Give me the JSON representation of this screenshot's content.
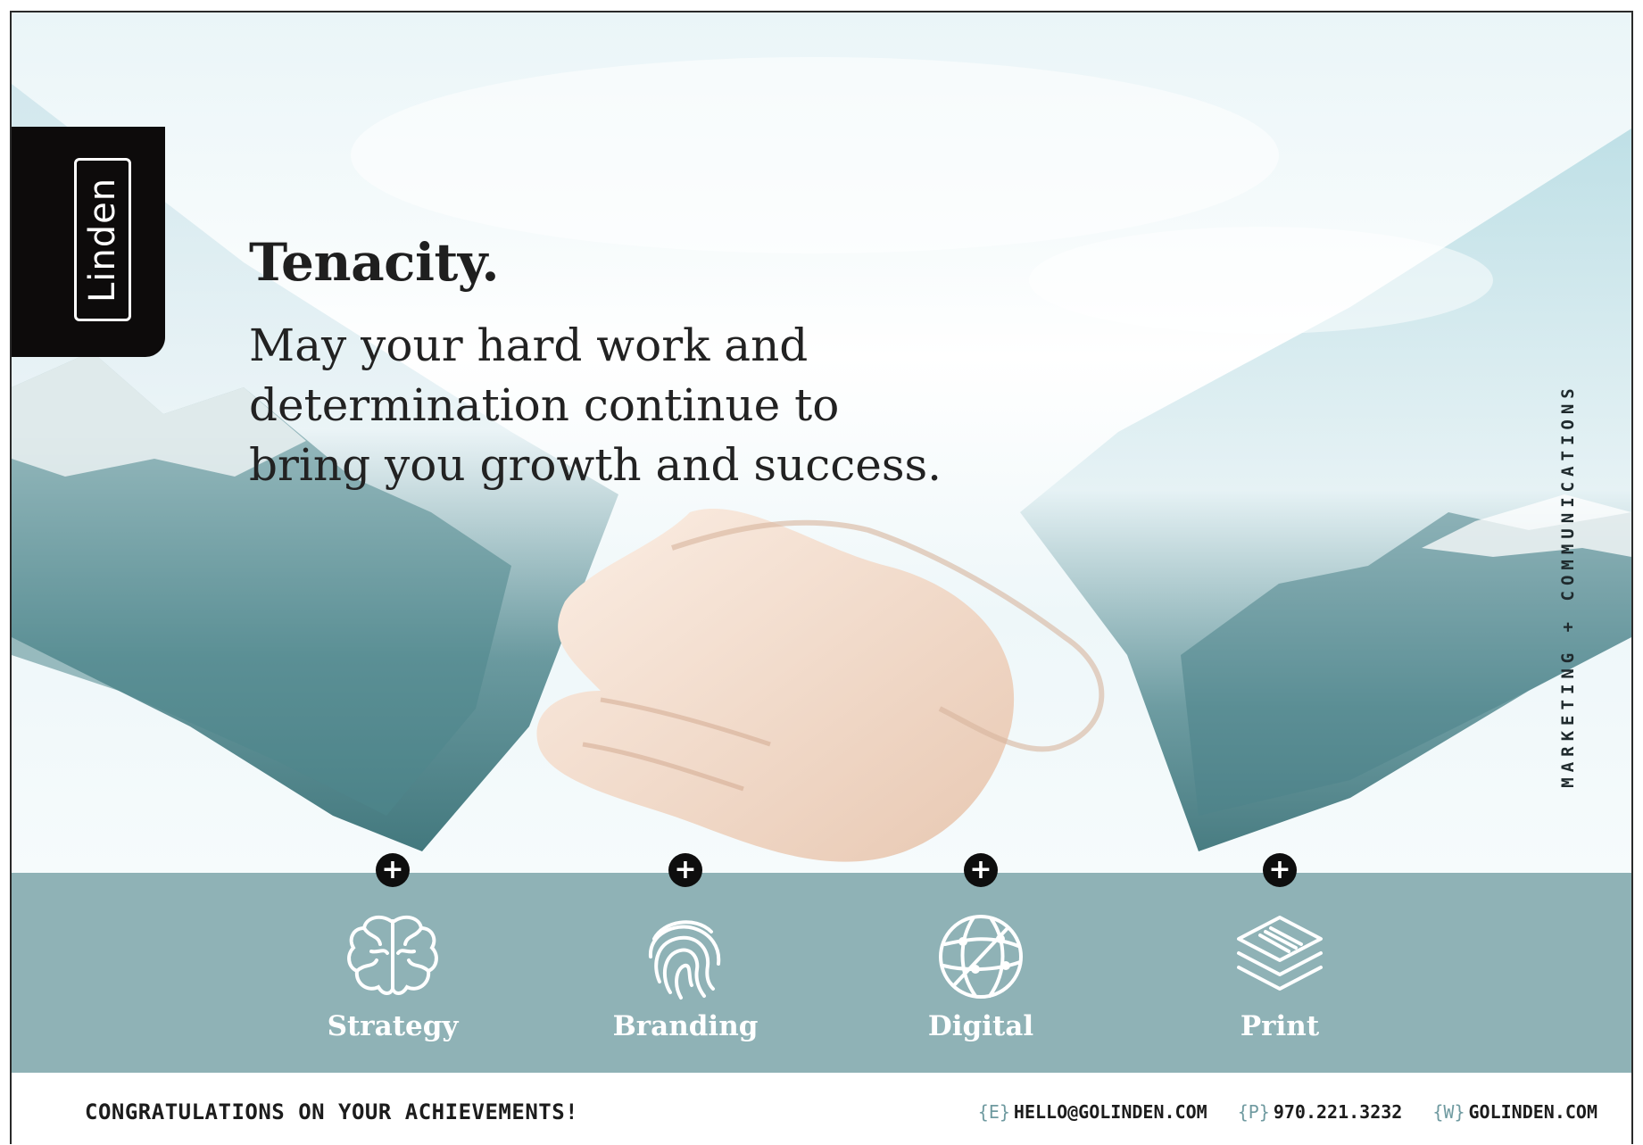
{
  "brand": {
    "logo_text": "Linden",
    "tagline_vertical": "MARKETING + COMMUNICATIONS"
  },
  "message": {
    "headline": "Tenacity.",
    "lines": [
      "May your hard work and",
      "determination continue to",
      "bring you growth and success."
    ]
  },
  "services": [
    {
      "label": "Strategy",
      "icon": "brain-icon",
      "plus": "+"
    },
    {
      "label": "Branding",
      "icon": "fingerprint-icon",
      "plus": "+"
    },
    {
      "label": "Digital",
      "icon": "globe-network-icon",
      "plus": "+"
    },
    {
      "label": "Print",
      "icon": "paper-stack-icon",
      "plus": "+"
    }
  ],
  "footer": {
    "congrats": "CONGRATULATIONS ON YOUR ACHIEVEMENTS!",
    "email_tag": "{E}",
    "email": "HELLO@GOLINDEN.COM",
    "phone_tag": "{P}",
    "phone": "970.221.3232",
    "web_tag": "{W}",
    "web": "GOLINDEN.COM"
  },
  "colors": {
    "band": "#8fb2b6",
    "logo_bg": "#0d0b0b",
    "accent_tag": "#6f9aa0"
  }
}
